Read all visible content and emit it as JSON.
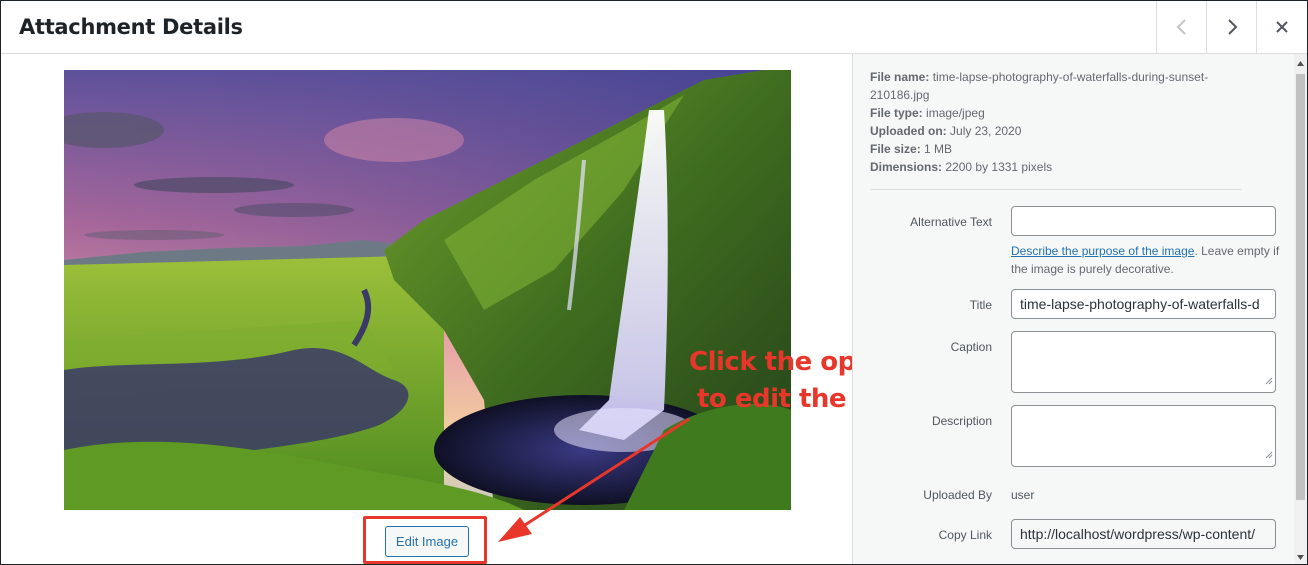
{
  "header": {
    "title": "Attachment Details",
    "prev_icon": "chevron-left-icon",
    "next_icon": "chevron-right-icon",
    "close_icon": "close-icon"
  },
  "media": {
    "image_description_icon": "waterfall-photo",
    "edit_button_label": "Edit Image"
  },
  "annotation": {
    "line1": "Click the option",
    "line2": "to edit the image",
    "color": "#e8372a"
  },
  "details": {
    "file_name_label": "File name:",
    "file_name_value": "time-lapse-photography-of-waterfalls-during-sunset-",
    "file_name_value2": "210186.jpg",
    "file_type_label": "File type:",
    "file_type_value": "image/jpeg",
    "uploaded_on_label": "Uploaded on:",
    "uploaded_on_value": "July 23, 2020",
    "file_size_label": "File size:",
    "file_size_value": "1 MB",
    "dimensions_label": "Dimensions:",
    "dimensions_value": "2200 by 1331 pixels"
  },
  "form": {
    "alt_label": "Alternative Text",
    "alt_value": "",
    "help_link": "Describe the purpose of the image",
    "help_rest": ". Leave empty if the image is purely decorative.",
    "title_label": "Title",
    "title_value": "time-lapse-photography-of-waterfalls-d",
    "caption_label": "Caption",
    "caption_value": "",
    "description_label": "Description",
    "description_value": "",
    "uploaded_by_label": "Uploaded By",
    "uploaded_by_value": "user",
    "copy_link_label": "Copy Link",
    "copy_link_value": "http://localhost/wordpress/wp-content/"
  },
  "colors": {
    "accent": "#2271b1",
    "annotation": "#e8372a"
  }
}
